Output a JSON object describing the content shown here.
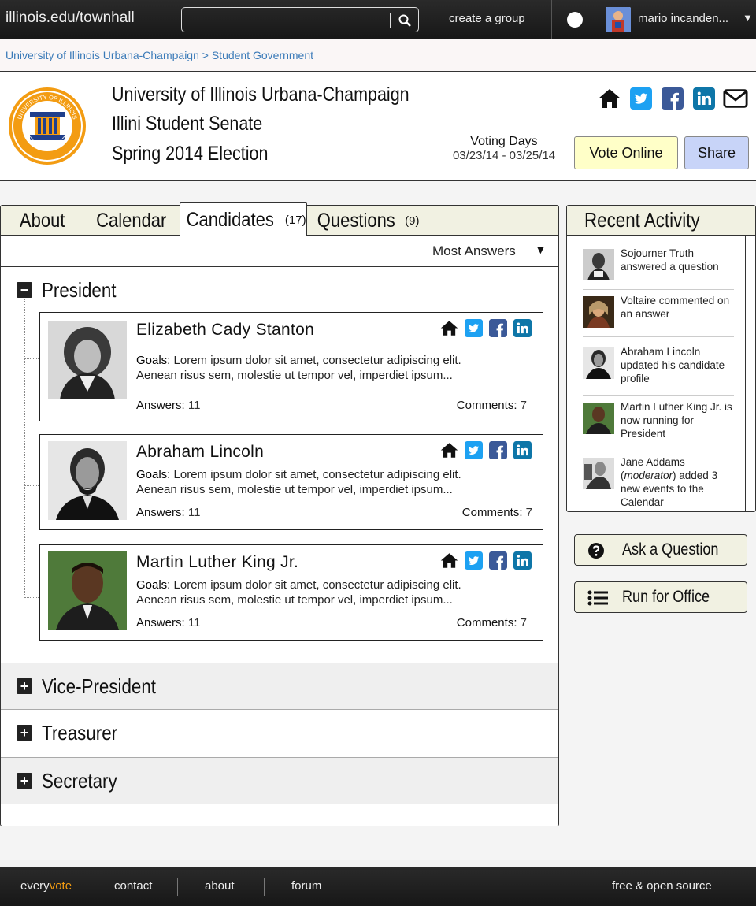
{
  "topbar": {
    "site_title": "illinois.edu/townhall",
    "search_placeholder": "",
    "create_group": "create a group",
    "user_name": "mario incanden...",
    "caret": "▼"
  },
  "breadcrumb": "University of Illinois Urbana-Champaign > Student Government",
  "header": {
    "line1": "University of Illinois Urbana-Champaign",
    "line2": "Illini Student Senate",
    "line3": "Spring 2014 Election",
    "voting_label": "Voting Days",
    "voting_dates": "03/23/14 - 03/25/14",
    "vote_button": "Vote Online",
    "share_button": "Share",
    "seal_text_top": "UNIVERSITY OF ILLINOIS",
    "seal_text_bottom": "STUDENT SENATE"
  },
  "tabs": [
    {
      "label": "About",
      "count": ""
    },
    {
      "label": "Calendar",
      "count": ""
    },
    {
      "label": "Candidates",
      "count": "(17)"
    },
    {
      "label": "Questions",
      "count": "(9)"
    }
  ],
  "sort": {
    "label": "Most Answers",
    "caret": "▼"
  },
  "sections": {
    "president": "President",
    "vice_president": "Vice-President",
    "treasurer": "Treasurer",
    "secretary": "Secretary"
  },
  "candidates": [
    {
      "name": "Elizabeth Cady Stanton",
      "goals_label": "Goals:",
      "goals_line1": "Lorem ipsum dolor sit amet, consectetur adipiscing elit.",
      "goals_line2": "Aenean risus sem, molestie ut tempor vel, imperdiet ipsum...",
      "answers_label": "Answers:",
      "answers": "11",
      "comments_label": "Comments:",
      "comments": "7"
    },
    {
      "name": "Abraham Lincoln",
      "goals_label": "Goals:",
      "goals_line1": "Lorem ipsum dolor sit amet, consectetur adipiscing elit.",
      "goals_line2": "Aenean risus sem, molestie ut tempor vel, imperdiet ipsum...",
      "answers_label": "Answers:",
      "answers": "11",
      "comments_label": "Comments:",
      "comments": "7"
    },
    {
      "name": "Martin Luther King Jr.",
      "goals_label": "Goals:",
      "goals_line1": "Lorem ipsum dolor sit amet, consectetur adipiscing elit.",
      "goals_line2": "Aenean risus sem, molestie ut tempor vel, imperdiet ipsum...",
      "answers_label": "Answers:",
      "answers": "11",
      "comments_label": "Comments:",
      "comments": "7"
    }
  ],
  "activity": {
    "title": "Recent Activity",
    "items": [
      {
        "text": "Sojourner Truth answered a question"
      },
      {
        "text": "Voltaire commented on an answer"
      },
      {
        "text": "Abraham Lincoln updated his candidate profile"
      },
      {
        "text": "Martin Luther King Jr. is now running for President"
      },
      {
        "text_pre": "Jane Addams (",
        "text_em": "moderator",
        "text_post": ") added 3 new events to the Calendar"
      }
    ]
  },
  "side_buttons": {
    "ask": "Ask a Question",
    "run": "Run for Office"
  },
  "footer": {
    "brand_every": "every",
    "brand_vote": "vote",
    "contact": "contact",
    "about": "about",
    "forum": "forum",
    "oss": "free & open source"
  },
  "colors": {
    "twitter": "#1da1f2",
    "facebook": "#3b5998",
    "linkedin": "#0e76a8",
    "brand_orange": "#f39c12",
    "link_blue": "#3a7ab8"
  }
}
